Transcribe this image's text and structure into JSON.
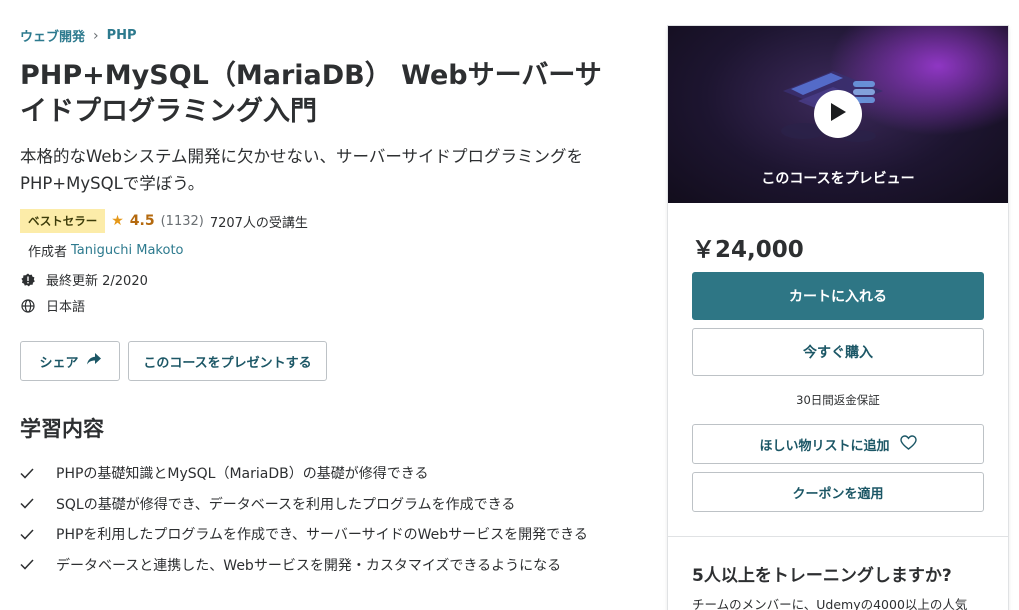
{
  "breadcrumb": {
    "items": [
      "ウェブ開発",
      "PHP"
    ],
    "separator": "›"
  },
  "course": {
    "title": "PHP+MySQL（MariaDB） Webサーバーサイドプログラミング入門",
    "subtitle": "本格的なWebシステム開発に欠かせない、サーバーサイドプログラミングをPHP+MySQLで学ぼう。",
    "badge": "ベストセラー",
    "rating": "4.5",
    "rating_count": "(1132)",
    "students": "7207人の受講生",
    "creator_label": "作成者",
    "creator_name": "Taniguchi Makoto",
    "last_updated": "最終更新 2/2020",
    "language": "日本語"
  },
  "actions": {
    "share_label": "シェア",
    "gift_label": "このコースをプレゼントする"
  },
  "learn": {
    "heading": "学習内容",
    "items": [
      "PHPの基礎知識とMySQL（MariaDB）の基礎が修得できる",
      "SQLの基礎が修得でき、データベースを利用したプログラムを作成できる",
      "PHPを利用したプログラムを作成でき、サーバーサイドのWebサービスを開発できる",
      "データベースと連携した、Webサービスを開発・カスタマイズできるようになる"
    ]
  },
  "sidebar": {
    "preview_label": "このコースをプレビュー",
    "price": "￥24,000",
    "cart_label": "カートに入れる",
    "buy_label": "今すぐ購入",
    "guarantee": "30日間返金保証",
    "wishlist_label": "ほしい物リストに追加",
    "coupon_label": "クーポンを適用",
    "team_heading": "5人以上をトレーニングしますか?",
    "team_text": "チームのメンバーに、Udemyの4000以上の人気"
  },
  "colors": {
    "link": "#2d7a8e",
    "primary_button": "#2e7685",
    "badge_bg": "#fceca9",
    "rating": "#b4690e"
  },
  "icons": [
    "chevron-right-icon",
    "star-icon",
    "alert-icon",
    "globe-icon",
    "share-arrow-icon",
    "check-icon",
    "play-icon",
    "heart-icon"
  ]
}
